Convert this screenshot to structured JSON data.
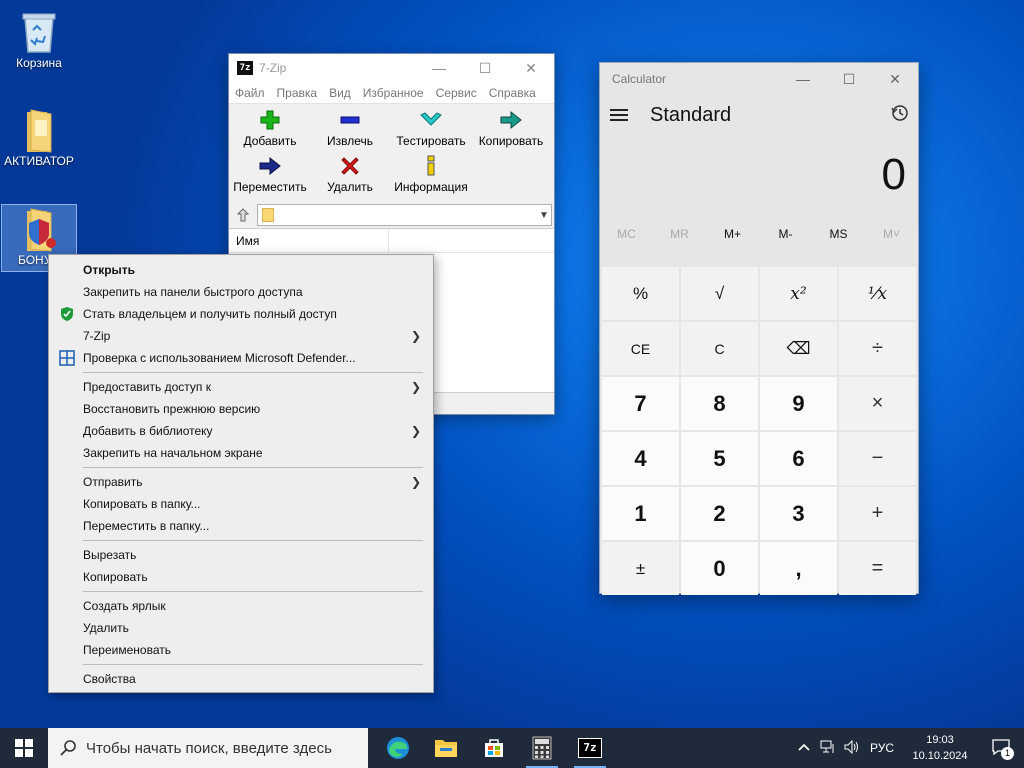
{
  "desktop": {
    "icons": [
      {
        "label": "Корзина"
      },
      {
        "label": "АКТИВАТОР"
      },
      {
        "label": "БОНУС"
      }
    ]
  },
  "sevenzip": {
    "title": "7-Zip",
    "app_icon_text": "7z",
    "menu": [
      "Файл",
      "Правка",
      "Вид",
      "Избранное",
      "Сервис",
      "Справка"
    ],
    "toolbar": [
      {
        "label": "Добавить",
        "icon": "plus-icon"
      },
      {
        "label": "Извлечь",
        "icon": "minus-icon"
      },
      {
        "label": "Тестировать",
        "icon": "check-icon"
      },
      {
        "label": "Копировать",
        "icon": "copy-arrow-icon"
      },
      {
        "label": "Переместить",
        "icon": "move-arrow-icon"
      },
      {
        "label": "Удалить",
        "icon": "delete-x-icon"
      },
      {
        "label": "Информация",
        "icon": "info-icon"
      }
    ],
    "address": "",
    "columns": [
      "Имя"
    ]
  },
  "calculator": {
    "title": "Calculator",
    "mode": "Standard",
    "display": "0",
    "memory": [
      {
        "label": "MC",
        "enabled": false
      },
      {
        "label": "MR",
        "enabled": false
      },
      {
        "label": "M+",
        "enabled": true
      },
      {
        "label": "M-",
        "enabled": true
      },
      {
        "label": "MS",
        "enabled": true
      },
      {
        "label": "M˅",
        "enabled": false
      }
    ],
    "keys": [
      {
        "label": "%",
        "type": "fn"
      },
      {
        "label": "√",
        "type": "fn"
      },
      {
        "label": "x²",
        "type": "fn"
      },
      {
        "label": "¹⁄x",
        "type": "fn"
      },
      {
        "label": "CE",
        "type": "fn"
      },
      {
        "label": "C",
        "type": "fn"
      },
      {
        "label": "⌫",
        "type": "fn"
      },
      {
        "label": "÷",
        "type": "op"
      },
      {
        "label": "7",
        "type": "num"
      },
      {
        "label": "8",
        "type": "num"
      },
      {
        "label": "9",
        "type": "num"
      },
      {
        "label": "×",
        "type": "op"
      },
      {
        "label": "4",
        "type": "num"
      },
      {
        "label": "5",
        "type": "num"
      },
      {
        "label": "6",
        "type": "num"
      },
      {
        "label": "−",
        "type": "op"
      },
      {
        "label": "1",
        "type": "num"
      },
      {
        "label": "2",
        "type": "num"
      },
      {
        "label": "3",
        "type": "num"
      },
      {
        "label": "+",
        "type": "op"
      },
      {
        "label": "±",
        "type": "fn"
      },
      {
        "label": "0",
        "type": "num"
      },
      {
        "label": ",",
        "type": "num"
      },
      {
        "label": "=",
        "type": "op"
      }
    ]
  },
  "context_menu": {
    "groups": [
      [
        {
          "label": "Открыть",
          "bold": true
        },
        {
          "label": "Закрепить на панели быстрого доступа"
        },
        {
          "label": "Стать владельцем и получить полный доступ",
          "icon": "shield-icon"
        },
        {
          "label": "7-Zip",
          "submenu": true
        },
        {
          "label": "Проверка с использованием Microsoft Defender...",
          "icon": "defender-icon"
        }
      ],
      [
        {
          "label": "Предоставить доступ к",
          "submenu": true
        },
        {
          "label": "Восстановить прежнюю версию"
        },
        {
          "label": "Добавить в библиотеку",
          "submenu": true
        },
        {
          "label": "Закрепить на начальном экране"
        }
      ],
      [
        {
          "label": "Отправить",
          "submenu": true
        },
        {
          "label": "Копировать в папку..."
        },
        {
          "label": "Переместить в папку..."
        }
      ],
      [
        {
          "label": "Вырезать"
        },
        {
          "label": "Копировать"
        }
      ],
      [
        {
          "label": "Создать ярлык"
        },
        {
          "label": "Удалить"
        },
        {
          "label": "Переименовать"
        }
      ],
      [
        {
          "label": "Свойства"
        }
      ]
    ]
  },
  "taskbar": {
    "search_placeholder": "Чтобы начать поиск, введите здесь",
    "apps": [
      "edge-icon",
      "file-explorer-icon",
      "store-icon",
      "calculator-icon",
      "7zip-icon"
    ],
    "active_apps": [
      "calculator-icon",
      "7zip-icon"
    ],
    "lang": "РУС",
    "time": "19:03",
    "date": "10.10.2024",
    "notifications": "1"
  }
}
